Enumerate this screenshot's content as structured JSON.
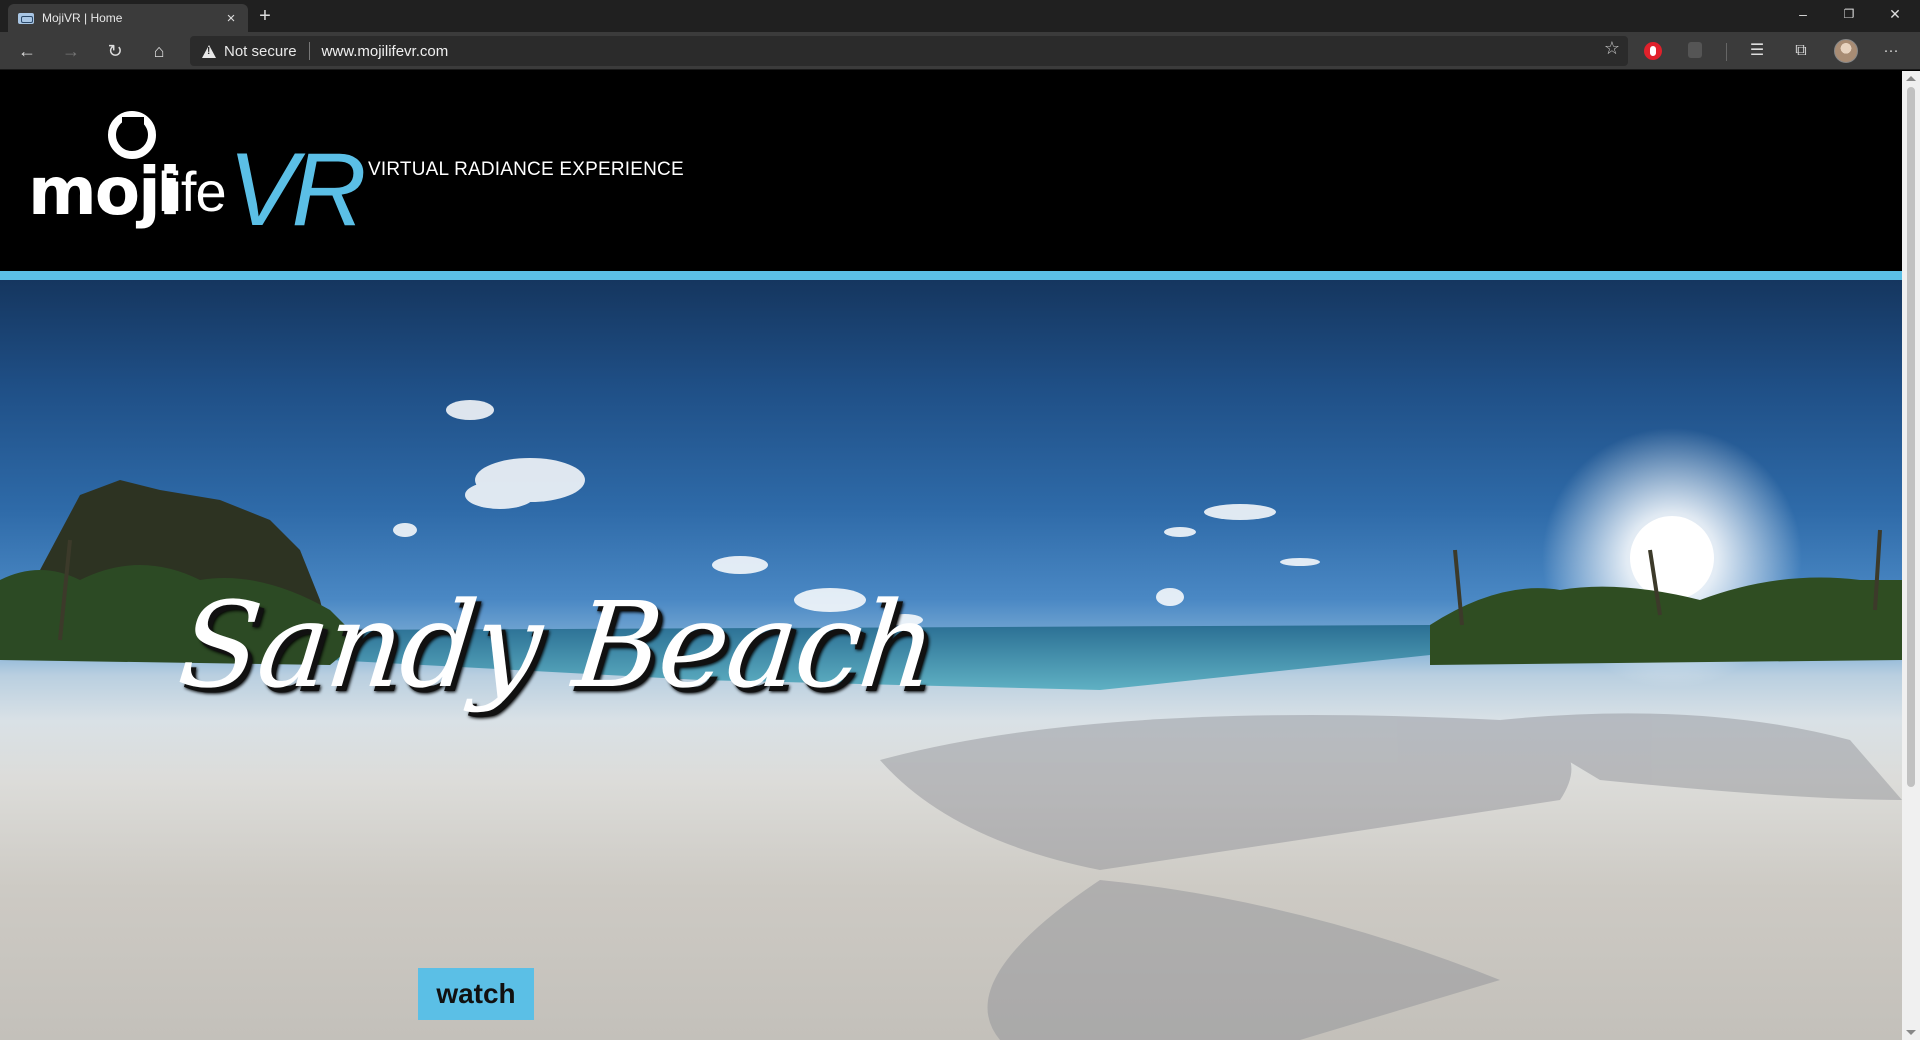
{
  "browser": {
    "tab_title": "MojiVR | Home",
    "tab_close": "×",
    "new_tab": "+",
    "window_buttons": {
      "minimize": "–",
      "restore": "❐",
      "close": "✕"
    },
    "nav": {
      "back": "←",
      "forward": "→",
      "reload": "↻",
      "home": "⌂"
    },
    "security_label": "Not secure",
    "url": "www.mojilifevr.com",
    "icons": [
      "back-icon",
      "forward-icon",
      "reload-icon",
      "home-icon",
      "warning-icon",
      "star-icon",
      "extension-icon",
      "favorites-icon",
      "collections-icon",
      "profile-avatar",
      "more-icon"
    ],
    "toolbar_glyphs": {
      "star": "☆",
      "favorites": "☰",
      "collections": "⧉",
      "more": "···"
    }
  },
  "site": {
    "logo": {
      "moji": "moji",
      "life": "life",
      "vr": "VR"
    },
    "tagline": "VIRTUAL RADIANCE EXPERIENCE",
    "accent_color": "#5bbfe6",
    "hero": {
      "title": "Sandy Beach",
      "button_label": "watch"
    }
  }
}
